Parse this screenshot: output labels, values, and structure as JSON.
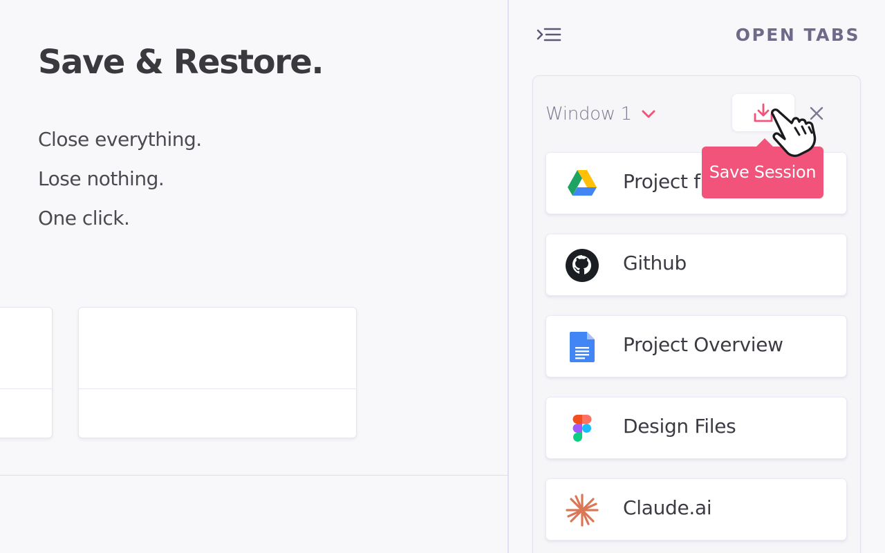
{
  "hero": {
    "title": "Save & Restore.",
    "lines": [
      "Close everything.",
      "Lose nothing.",
      "One click."
    ]
  },
  "panel": {
    "heading": "OPEN TABS",
    "window": {
      "name": "Window 1",
      "tooltip": "Save Session",
      "tabs": [
        {
          "title": "Project files",
          "icon": "google-drive-icon"
        },
        {
          "title": "Github",
          "icon": "github-icon"
        },
        {
          "title": "Project Overview",
          "icon": "google-docs-icon"
        },
        {
          "title": "Design Files",
          "icon": "figma-icon"
        },
        {
          "title": "Claude.ai",
          "icon": "claude-icon"
        }
      ]
    }
  },
  "colors": {
    "accent": "#f2537a",
    "heading": "#6e6a88",
    "window_name": "#7b7891",
    "border": "#e3e0f3"
  },
  "icons": {
    "collapse": "collapse-sidebar-icon",
    "chevron": "chevron-down-icon",
    "save": "download-icon",
    "close": "close-icon",
    "cursor": "hand-pointer-icon"
  }
}
